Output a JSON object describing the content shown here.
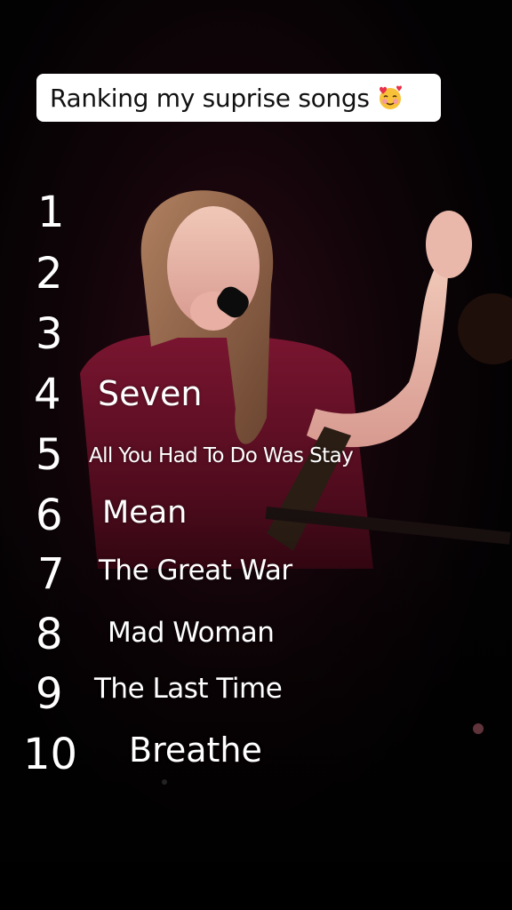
{
  "caption": {
    "text": "Ranking my suprise songs",
    "emoji": "smiling-face-with-hearts-icon"
  },
  "ranks": [
    "1",
    "2",
    "3",
    "4",
    "5",
    "6",
    "7",
    "8",
    "9",
    "10"
  ],
  "songs": {
    "4": "Seven",
    "5": "All You Had To Do Was Stay",
    "6": "Mean",
    "7": "The Great War",
    "8": "Mad Woman",
    "9": "The Last Time",
    "10": "Breathe"
  }
}
